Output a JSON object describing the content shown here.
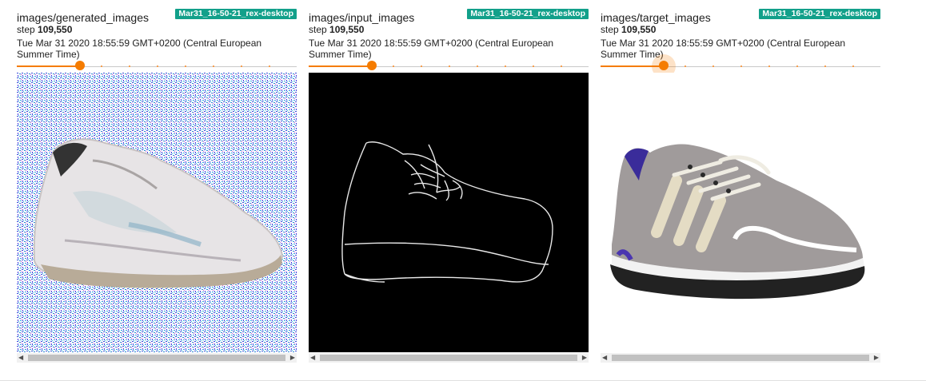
{
  "cards": [
    {
      "title": "images/generated_images",
      "run": "Mar31_16-50-21_rex-desktop",
      "step_label": "step",
      "step_value": "109,550",
      "wall_time": "Tue Mar 31 2020 18:55:59 GMT+0200 (Central European Summer Time)",
      "slider": {
        "value": 0.225,
        "active": false
      },
      "image_icon": "generated-shoe-image"
    },
    {
      "title": "images/input_images",
      "run": "Mar31_16-50-21_rex-desktop",
      "step_label": "step",
      "step_value": "109,550",
      "wall_time": "Tue Mar 31 2020 18:55:59 GMT+0200 (Central European Summer Time)",
      "slider": {
        "value": 0.225,
        "active": false
      },
      "image_icon": "shoe-edge-sketch-image"
    },
    {
      "title": "images/target_images",
      "run": "Mar31_16-50-21_rex-desktop",
      "step_label": "step",
      "step_value": "109,550",
      "wall_time": "Tue Mar 31 2020 18:55:59 GMT+0200 (Central European Summer Time)",
      "slider": {
        "value": 0.225,
        "active": true
      },
      "image_icon": "sneaker-photo-image"
    }
  ],
  "colors": {
    "accent": "#f57c00",
    "run_badge": "#12a08a"
  }
}
